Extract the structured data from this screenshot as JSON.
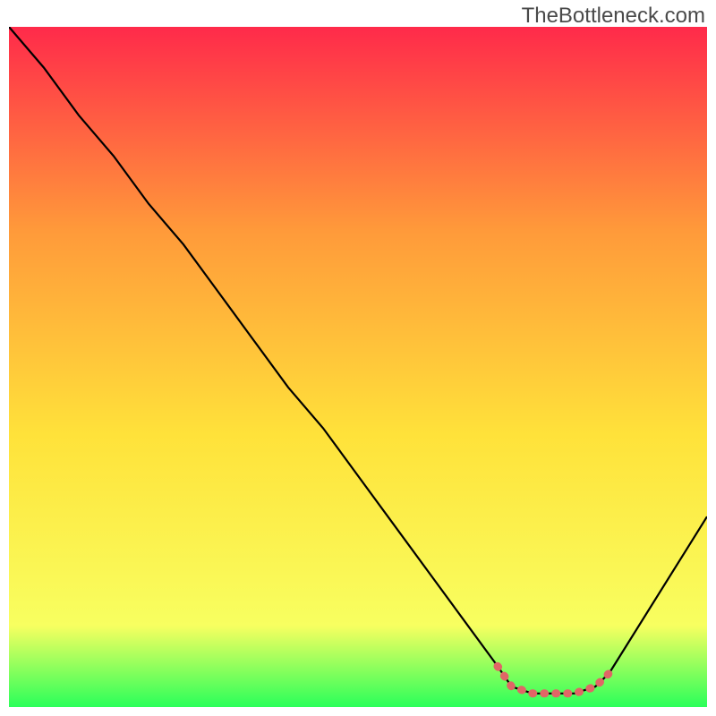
{
  "watermark": "TheBottleneck.com",
  "chart_data": {
    "type": "line",
    "title": "",
    "xlabel": "",
    "ylabel": "",
    "xlim": [
      0,
      100
    ],
    "ylim": [
      0,
      100
    ],
    "background_gradient": {
      "top": "#ff2a4a",
      "upper_mid": "#ff9a3a",
      "mid": "#ffe23a",
      "lower_mid": "#f8ff60",
      "bottom": "#2aff5a"
    },
    "series": [
      {
        "name": "curve",
        "stroke": "#000000",
        "x": [
          0,
          5,
          10,
          15,
          20,
          25,
          30,
          35,
          40,
          45,
          50,
          55,
          60,
          65,
          70,
          72,
          75,
          78,
          81,
          84,
          86,
          100
        ],
        "y": [
          100,
          94,
          87,
          81,
          74,
          68,
          61,
          54,
          47,
          41,
          34,
          27,
          20,
          13,
          6,
          3,
          2,
          2,
          2,
          3,
          5,
          28
        ]
      },
      {
        "name": "marker-band",
        "stroke": "#e06666",
        "style": "thick",
        "segments": [
          {
            "x": [
              70,
              72,
              75,
              78,
              81,
              84,
              86
            ],
            "y": [
              6,
              3,
              2,
              2,
              2,
              3,
              5
            ]
          }
        ]
      }
    ]
  }
}
